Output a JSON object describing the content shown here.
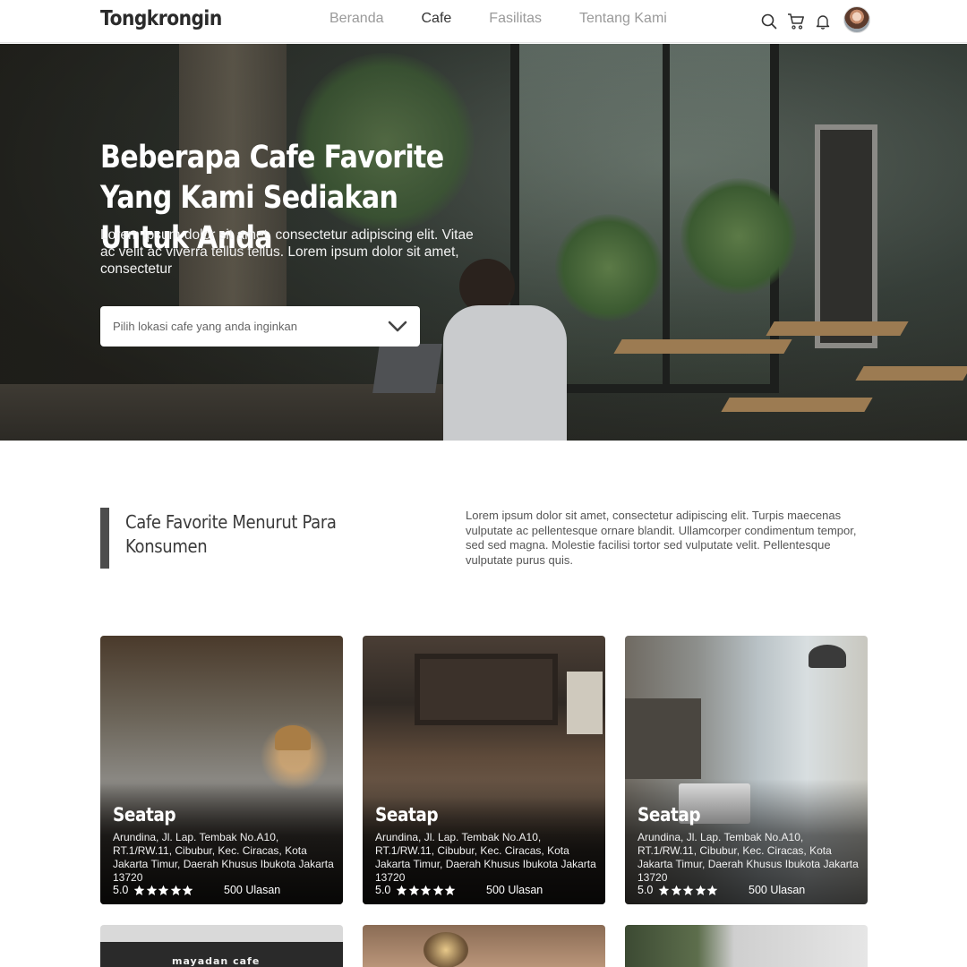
{
  "nav": {
    "brand": "Tongkrongin",
    "links": [
      "Beranda",
      "Cafe",
      "Fasilitas",
      "Tentang Kami"
    ],
    "active": "Cafe",
    "icons": [
      "search-icon",
      "cart-icon",
      "bell-icon"
    ]
  },
  "hero": {
    "title": "Beberapa Cafe Favorite Yang Kami Sediakan Untuk Anda",
    "subtitle": "Lorem ipsum dolor sit amet, consectetur adipiscing elit. Vitae ac velit ac viverra tellus tellus. Lorem ipsum dolor sit amet, consectetur",
    "select_placeholder": "Pilih lokasi cafe yang anda inginkan",
    "select_icon": "chevron-down-icon"
  },
  "section": {
    "title": "Cafe Favorite Menurut Para Konsumen",
    "description": "Lorem ipsum dolor sit amet, consectetur adipiscing elit. Turpis maecenas vulputate ac pellentesque ornare blandit. Ullamcorper condimentum tempor, sed sed magna. Molestie facilisi tortor sed vulputate velit. Pellentesque vulputate purus quis."
  },
  "cards": [
    {
      "name": "Seatap",
      "address": "Arundina, Jl. Lap. Tembak No.A10, RT.1/RW.11, Cibubur, Kec. Ciracas, Kota Jakarta Timur, Daerah Khusus Ibukota Jakarta 13720",
      "rating": "5.0",
      "stars": 5,
      "reviews": "500 Ulasan"
    },
    {
      "name": "Seatap",
      "address": "Arundina, Jl. Lap. Tembak No.A10, RT.1/RW.11, Cibubur, Kec. Ciracas, Kota Jakarta Timur, Daerah Khusus Ibukota Jakarta 13720",
      "rating": "5.0",
      "stars": 5,
      "reviews": "500 Ulasan"
    },
    {
      "name": "Seatap",
      "address": "Arundina, Jl. Lap. Tembak No.A10, RT.1/RW.11, Cibubur, Kec. Ciracas, Kota Jakarta Timur, Daerah Khusus Ibukota Jakarta 13720",
      "rating": "5.0",
      "stars": 5,
      "reviews": "500 Ulasan"
    }
  ],
  "partial_cards": {
    "first_sign": "mayadan cafe"
  },
  "colors": {
    "accent_bar": "#4d4d4d",
    "nav_inactive": "#9a9a9a",
    "nav_active": "#333333"
  }
}
